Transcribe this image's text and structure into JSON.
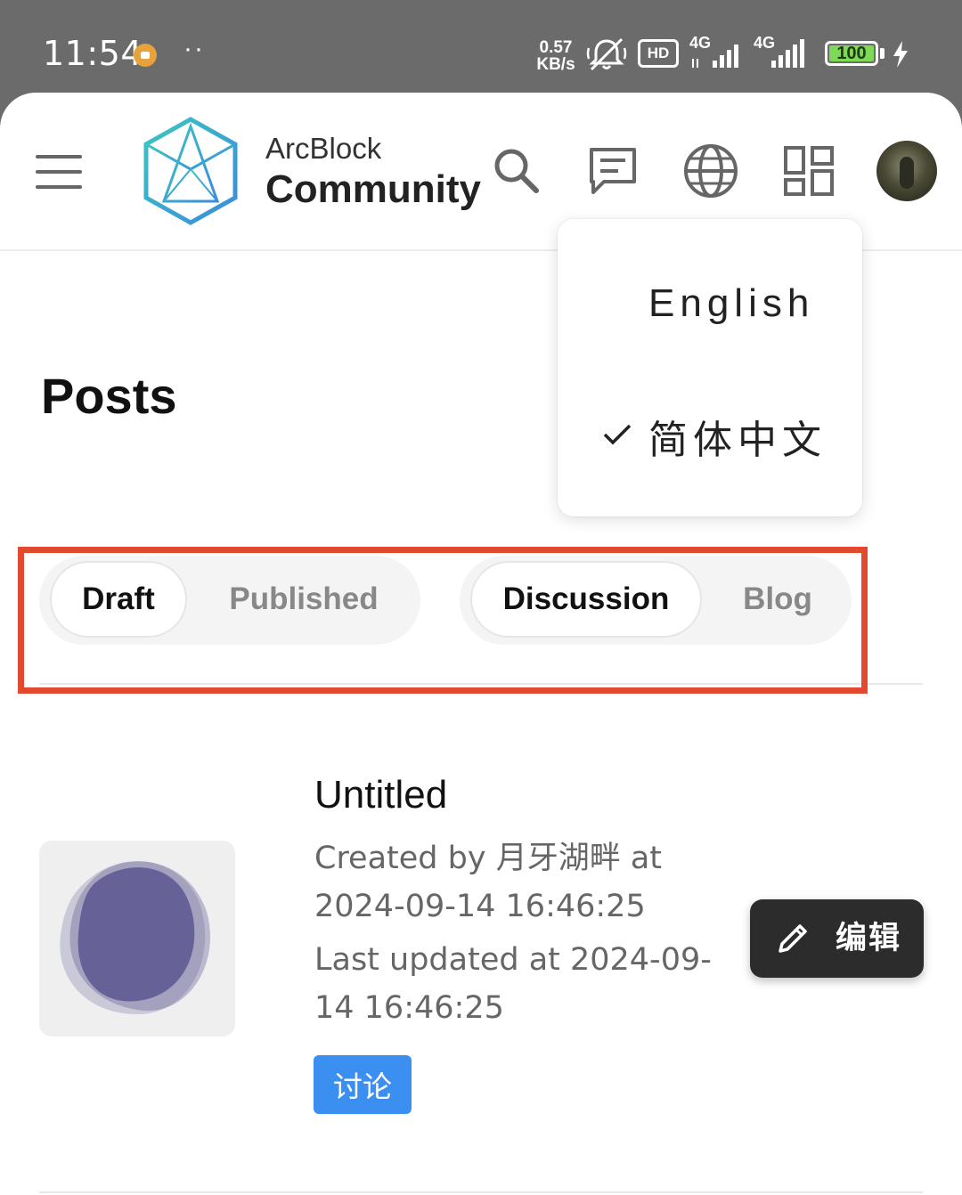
{
  "status_bar": {
    "time": "11:54",
    "dots": "··",
    "net_speed_value": "0.57",
    "net_speed_unit": "KB/s",
    "hd_label": "HD",
    "signal_label_1": "4G",
    "signal_label_2": "4G",
    "battery": "100"
  },
  "header": {
    "brand_line1": "ArcBlock",
    "brand_line2": "Community"
  },
  "language_menu": {
    "items": [
      {
        "label": "English",
        "selected": false
      },
      {
        "label": "简体中文",
        "selected": true
      }
    ]
  },
  "page": {
    "title": "Posts"
  },
  "filters": {
    "status_tabs": [
      {
        "label": "Draft",
        "active": true
      },
      {
        "label": "Published",
        "active": false
      }
    ],
    "type_tabs": [
      {
        "label": "Discussion",
        "active": true
      },
      {
        "label": "Blog",
        "active": false
      }
    ]
  },
  "post": {
    "title": "Untitled",
    "created_line1": "Created by 月牙湖畔 at",
    "created_line2": "2024-09-14 16:46:25",
    "updated_line1": "Last updated at 2024-09-",
    "updated_line2": "14 16:46:25",
    "tag": "讨论",
    "edit_label": "编辑"
  },
  "colors": {
    "status_bar_bg": "#6b6b6b",
    "highlight_border": "#e24a2f",
    "tag_bg": "#3b8ff0",
    "edit_button_bg": "#2c2c2c",
    "logo_teal": "#3cc6c0",
    "logo_blue": "#3a8be0",
    "thumb_blob": "#5c5690"
  },
  "icons": [
    "hamburger-icon",
    "search-icon",
    "message-icon",
    "globe-icon",
    "grid-icon",
    "check-icon",
    "pencil-icon"
  ]
}
